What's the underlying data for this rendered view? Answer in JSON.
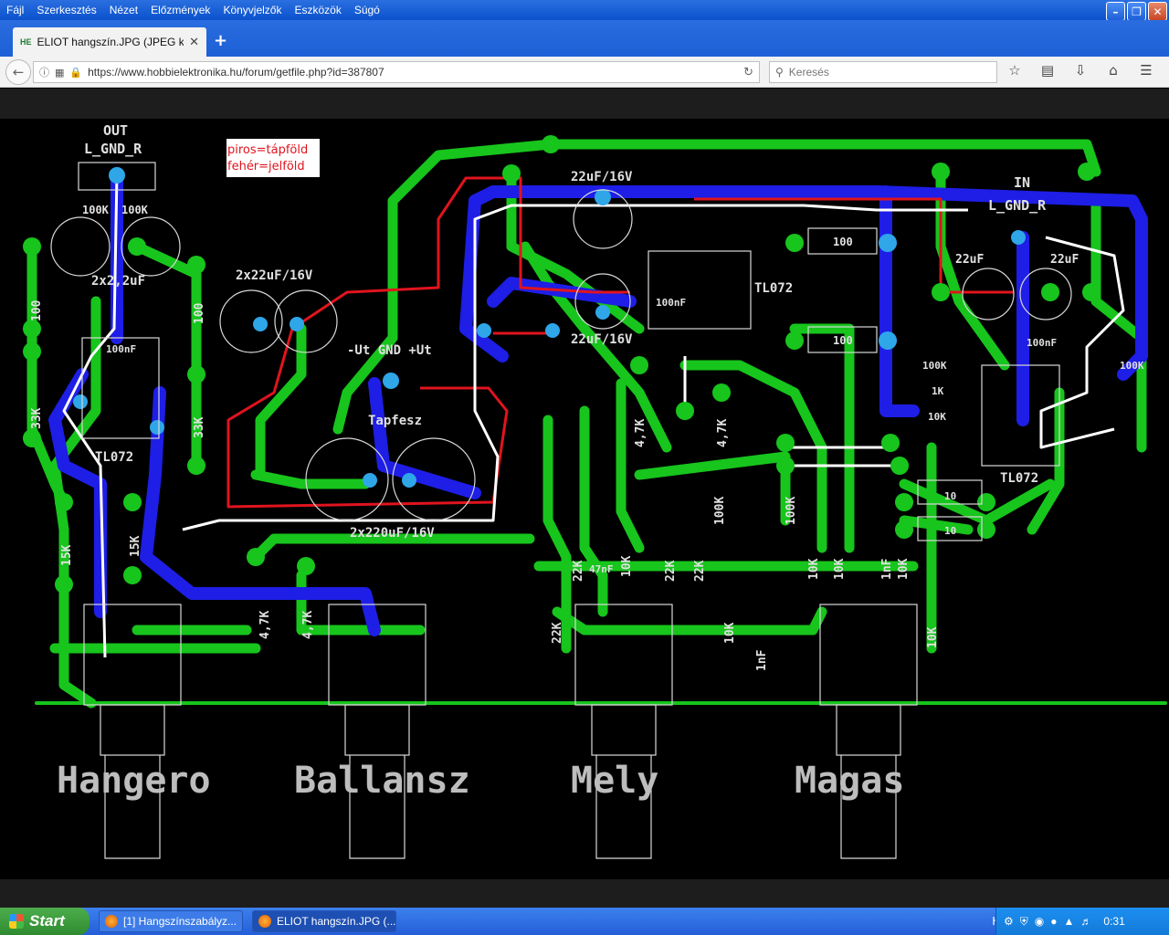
{
  "menu": [
    "Fájl",
    "Szerkesztés",
    "Nézet",
    "Előzmények",
    "Könyvjelzők",
    "Eszközök",
    "Súgó"
  ],
  "tab": {
    "favicon": "HE",
    "title": "ELIOT hangszín.JPG (JPEG ké..."
  },
  "nav": {
    "url": "https://www.hobbielektronika.hu/forum/getfile.php?id=387807",
    "search_placeholder": "Keresés"
  },
  "pcb": {
    "legend1": "piros=tápföld",
    "legend2": "fehér=jelföld",
    "out": "OUT",
    "out_pins": "L_GND_R",
    "in": "IN",
    "in_pins": "L_GND_R",
    "power_pins": "-Ut GND +Ut",
    "power_label": "Tapfesz",
    "cap_2x22": "2x22uF/16V",
    "cap_2x2_2": "2x2,2uF",
    "cap_2x220": "2x220uF/16V",
    "cap_22a": "22uF/16V",
    "cap_22b": "22uF/16V",
    "cap_22in_l": "22uF",
    "cap_22in_r": "22uF",
    "ic_left": "TL072",
    "ic_mid": "TL072",
    "ic_right": "TL072",
    "r100k_a": "100K",
    "r100k_b": "100K",
    "r100_left": "100",
    "r100_mid": "100",
    "r33k_a": "33K",
    "r33k_b": "33K",
    "r15k_a": "15K",
    "r15k_b": "15K",
    "r47k_a": "4,7K",
    "r47k_b": "4,7K",
    "r100_top1": "100",
    "r100_top2": "100",
    "c100nf_a": "100nF",
    "c100nf_b": "100nF",
    "c100nf_c": "100nF",
    "r10k": "10K",
    "r1k": "1K",
    "r10": "10",
    "r22k": "22K",
    "c47nf": "47nF",
    "c1nf": "1nF",
    "pot_labels": [
      "Hangero",
      "Ballansz",
      "Mely",
      "Magas"
    ]
  },
  "taskbar": {
    "start": "Start",
    "tasks": [
      "[1] Hangszínszabályz...",
      "ELIOT hangszín.JPG (..."
    ],
    "lang": "HU",
    "time": "0:31"
  }
}
